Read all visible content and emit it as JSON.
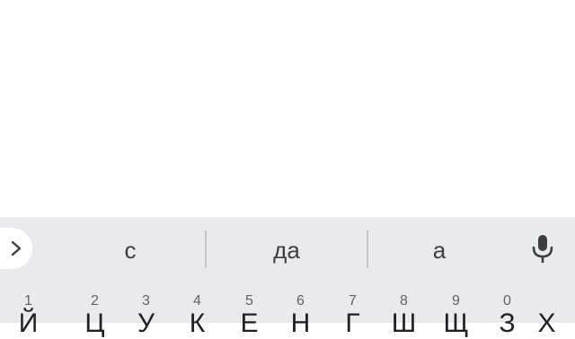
{
  "content": {
    "clipped_text": "· · · · · · · ·"
  },
  "suggestions": [
    {
      "label": "с"
    },
    {
      "label": "да"
    },
    {
      "label": "а"
    }
  ],
  "toolbar": {
    "expand_icon": "chevron-right-icon",
    "mic_icon": "microphone-icon"
  },
  "keyboard": {
    "row1": [
      {
        "hint": "1",
        "letter": "Й"
      },
      {
        "hint": "2",
        "letter": "Ц"
      },
      {
        "hint": "3",
        "letter": "У"
      },
      {
        "hint": "4",
        "letter": "К"
      },
      {
        "hint": "5",
        "letter": "Е"
      },
      {
        "hint": "6",
        "letter": "Н"
      },
      {
        "hint": "7",
        "letter": "Г"
      },
      {
        "hint": "8",
        "letter": "Ш"
      },
      {
        "hint": "9",
        "letter": "Щ"
      },
      {
        "hint": "0",
        "letter": "З"
      },
      {
        "hint": "",
        "letter": "Х"
      }
    ]
  },
  "colors": {
    "keyboard_bg": "#e8eaed",
    "icon": "#3c4043"
  }
}
